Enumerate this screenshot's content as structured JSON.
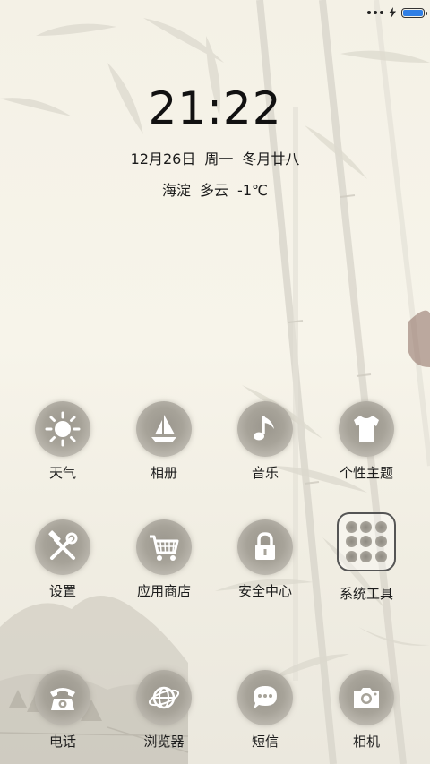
{
  "status_bar": {
    "signal_icon": "signal-dots-icon",
    "charging_icon": "lightning-icon",
    "battery_level": 1.0,
    "battery_color": "#2f7fe6"
  },
  "lockscreen": {
    "time": "21:22",
    "date": "12月26日",
    "weekday": "周一",
    "lunar_date": "冬月廿八",
    "location": "海淀",
    "weather": "多云",
    "temperature": "-1℃"
  },
  "apps_row1": [
    {
      "label": "天气",
      "icon": "sun-icon"
    },
    {
      "label": "相册",
      "icon": "sailboat-icon"
    },
    {
      "label": "音乐",
      "icon": "music-note-icon"
    },
    {
      "label": "个性主题",
      "icon": "tshirt-icon"
    }
  ],
  "apps_row2": [
    {
      "label": "设置",
      "icon": "hammer-wrench-icon"
    },
    {
      "label": "应用商店",
      "icon": "shopping-cart-icon"
    },
    {
      "label": "安全中心",
      "icon": "lock-icon"
    },
    {
      "label": "系统工具",
      "icon": "app-grid-icon"
    }
  ],
  "dock": [
    {
      "label": "电话",
      "icon": "telephone-icon"
    },
    {
      "label": "浏览器",
      "icon": "globe-icon"
    },
    {
      "label": "短信",
      "icon": "chat-bubble-icon"
    },
    {
      "label": "相机",
      "icon": "camera-icon"
    }
  ]
}
